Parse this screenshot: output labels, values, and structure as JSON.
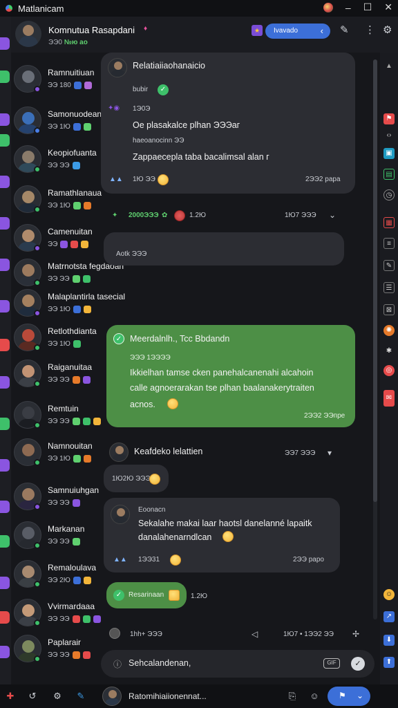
{
  "window": {
    "title": "Matlanicam"
  },
  "header": {
    "name": "Komnutua Rasapdani",
    "pin": "♦",
    "sub_count": "ЭЭ0",
    "sub_badge": "№ю ао",
    "pill_label": "Ivavado"
  },
  "contacts": [
    {
      "name": "Ramnuitiuan",
      "meta": "ЭЭ 180",
      "av_head": "#6a6f78",
      "av_body": "#2b2f36",
      "status": "#8a55e0"
    },
    {
      "name": "Samonuodean",
      "meta": "ЭЭ 1Ю",
      "av_head": "#3b6fb8",
      "av_body": "#25426e",
      "status": "#4a7ee6"
    },
    {
      "name": "Keopiofuanta",
      "meta": "ЭЭ ЭЭ",
      "av_head": "#8a7b6a",
      "av_body": "#2f4a5a",
      "status": "#3ec06a"
    },
    {
      "name": "Ramathlanaua",
      "meta": "ЭЭ 1Ю",
      "av_head": "#a58868",
      "av_body": "#1f2a38",
      "status": "#3ec06a"
    },
    {
      "name": "Camenuitan",
      "meta": "ЭЭ",
      "av_head": "#b08b6c",
      "av_body": "#2a3b4e",
      "status": "#8a55e0"
    },
    {
      "name": "Matrnotsta fegdaoan",
      "meta": "ЭЭ ЭЭ",
      "av_head": "#9c7a5e",
      "av_body": "#2a2f38",
      "status": "#3ec06a"
    },
    {
      "name": "Malaplantirla tasecial",
      "meta": "ЭЭ 1Ю",
      "av_head": "#a4805f",
      "av_body": "#1f2c3d",
      "status": "#8a55e0"
    },
    {
      "name": "Retlothdianta",
      "meta": "ЭЭ 1Ю",
      "av_head": "#b94a3a",
      "av_body": "#5a2a22",
      "status": "#3ec06a"
    },
    {
      "name": "Raiganuitaa",
      "meta": "ЭЭ ЭЭ",
      "av_head": "#c29374",
      "av_body": "#3b3f46",
      "status": "#3ec06a"
    },
    {
      "name": "Remtuin",
      "meta": "ЭЭ ЭЭ",
      "av_head": "#3a3d44",
      "av_body": "#1b1d22",
      "status": "#3ec06a"
    },
    {
      "name": "Namnouitan",
      "meta": "ЭЭ 1Ю",
      "av_head": "#8d6a52",
      "av_body": "#2a2e35",
      "status": "#3ec06a"
    },
    {
      "name": "Samnuiuhgan",
      "meta": "ЭЭ ЭЭ",
      "av_head": "#9a7a60",
      "av_body": "#2a2540",
      "status": "#8a55e0"
    },
    {
      "name": "Markanan",
      "meta": "ЭЭ ЭЭ",
      "av_head": "#595d66",
      "av_body": "#26292f",
      "status": "#3ec06a"
    },
    {
      "name": "Remaloulava",
      "meta": "ЭЭ 2Ю",
      "av_head": "#a88a70",
      "av_body": "#3a3f44",
      "status": "#3ec06a"
    },
    {
      "name": "Vvirmardaaa",
      "meta": "ЭЭ ЭЭ",
      "av_head": "#c49a78",
      "av_body": "#3b3f46",
      "status": "#3ec06a"
    },
    {
      "name": "Paplarair",
      "meta": "ЭЭ ЭЭ",
      "av_head": "#7d8a5e",
      "av_body": "#2e3a2a",
      "status": "#3ec06a"
    }
  ],
  "messages": {
    "m1": {
      "title": "Relatiaiiaohanaicio",
      "sub1": "bubir",
      "sub2": "1Э0Э",
      "line1": "Oe plasakalce plhan  ЭЭЭаг",
      "sub3": "haeoanocinn ЭЭ",
      "line2": "Zappaecepla taba bacalimsal alan г",
      "time_left": "1Ю ЭЭ",
      "time_right": "2ЭЭ2 papa"
    },
    "m2": {
      "count": "2000ЭЭЭ",
      "time": "1.2Ю",
      "right": "1Ю7 ЭЭЭ"
    },
    "m3": {
      "text": "Aotk ЭЭЭ"
    },
    "m4": {
      "title": "Meerdalnlh., Tcc Bbdandn",
      "sub": "ЭЭЭ 1ЭЭЭЭ",
      "line1": "Ikkielhan tamse cken panehalcanenahi alcahoin",
      "line2": "calle agnoerarakan tse plhan baalanakerytraiten",
      "line3": "acnos.",
      "time": "2ЭЭ2 ЭЭпpe"
    },
    "m5": {
      "name": "Keafdeko lelattien",
      "time": "1Ю2Ю ЭЭЭ",
      "right": "ЭЭ7 ЭЭЭ"
    },
    "m6": {
      "author": "Eoonacn",
      "line1": "Sekalahe makai laar haotsl danelanné lapaitk",
      "line2": "danalahenarndlcan",
      "time": "1ЭЭ31",
      "right": "2ЭЭ papo"
    },
    "m7": {
      "label": "Resarinaan",
      "time": "1.2Ю"
    },
    "m8": {
      "left": "1hh+ ЭЭЭ",
      "right": "1Ю7 • 1ЭЭ2 ЭЭ"
    }
  },
  "composer": {
    "placeholder": "Sehcalandenan,",
    "gif": "GIF"
  },
  "footer": {
    "user": "Ratomihiaiionennat..."
  },
  "colors": {
    "accent": "#3c6fd8",
    "bubble_green": "#4d8f46",
    "bubble_dark": "#2c2d33",
    "online": "#3ec06a"
  }
}
